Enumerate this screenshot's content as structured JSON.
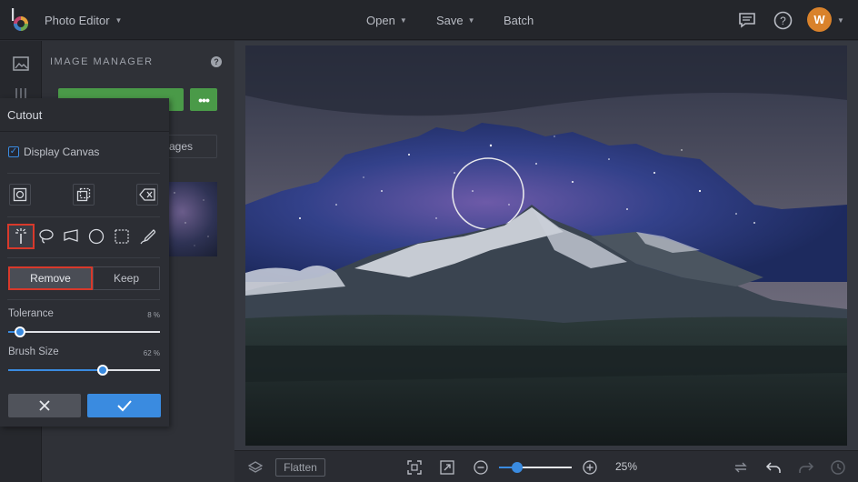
{
  "app": {
    "title": "Photo Editor"
  },
  "menu": {
    "open": "Open",
    "save": "Save",
    "batch": "Batch"
  },
  "user": {
    "initial": "W"
  },
  "image_manager": {
    "title": "IMAGE MANAGER",
    "help": "?",
    "more": "•••",
    "images_tab": "ages"
  },
  "cutout": {
    "title": "Cutout",
    "display_canvas_label": "Display Canvas",
    "display_canvas_checked": true,
    "modes": {
      "remove": "Remove",
      "keep": "Keep",
      "selected": "remove"
    },
    "tolerance": {
      "label": "Tolerance",
      "value_text": "8 %",
      "value": 8
    },
    "brush_size": {
      "label": "Brush Size",
      "value_text": "62 %",
      "value": 62
    }
  },
  "bottom": {
    "flatten": "Flatten",
    "zoom_text": "25%",
    "zoom": 0.25
  },
  "colors": {
    "accent": "#3a8be0",
    "highlight": "#d8392b",
    "green": "#4a9a48",
    "avatar": "#d9822b"
  }
}
